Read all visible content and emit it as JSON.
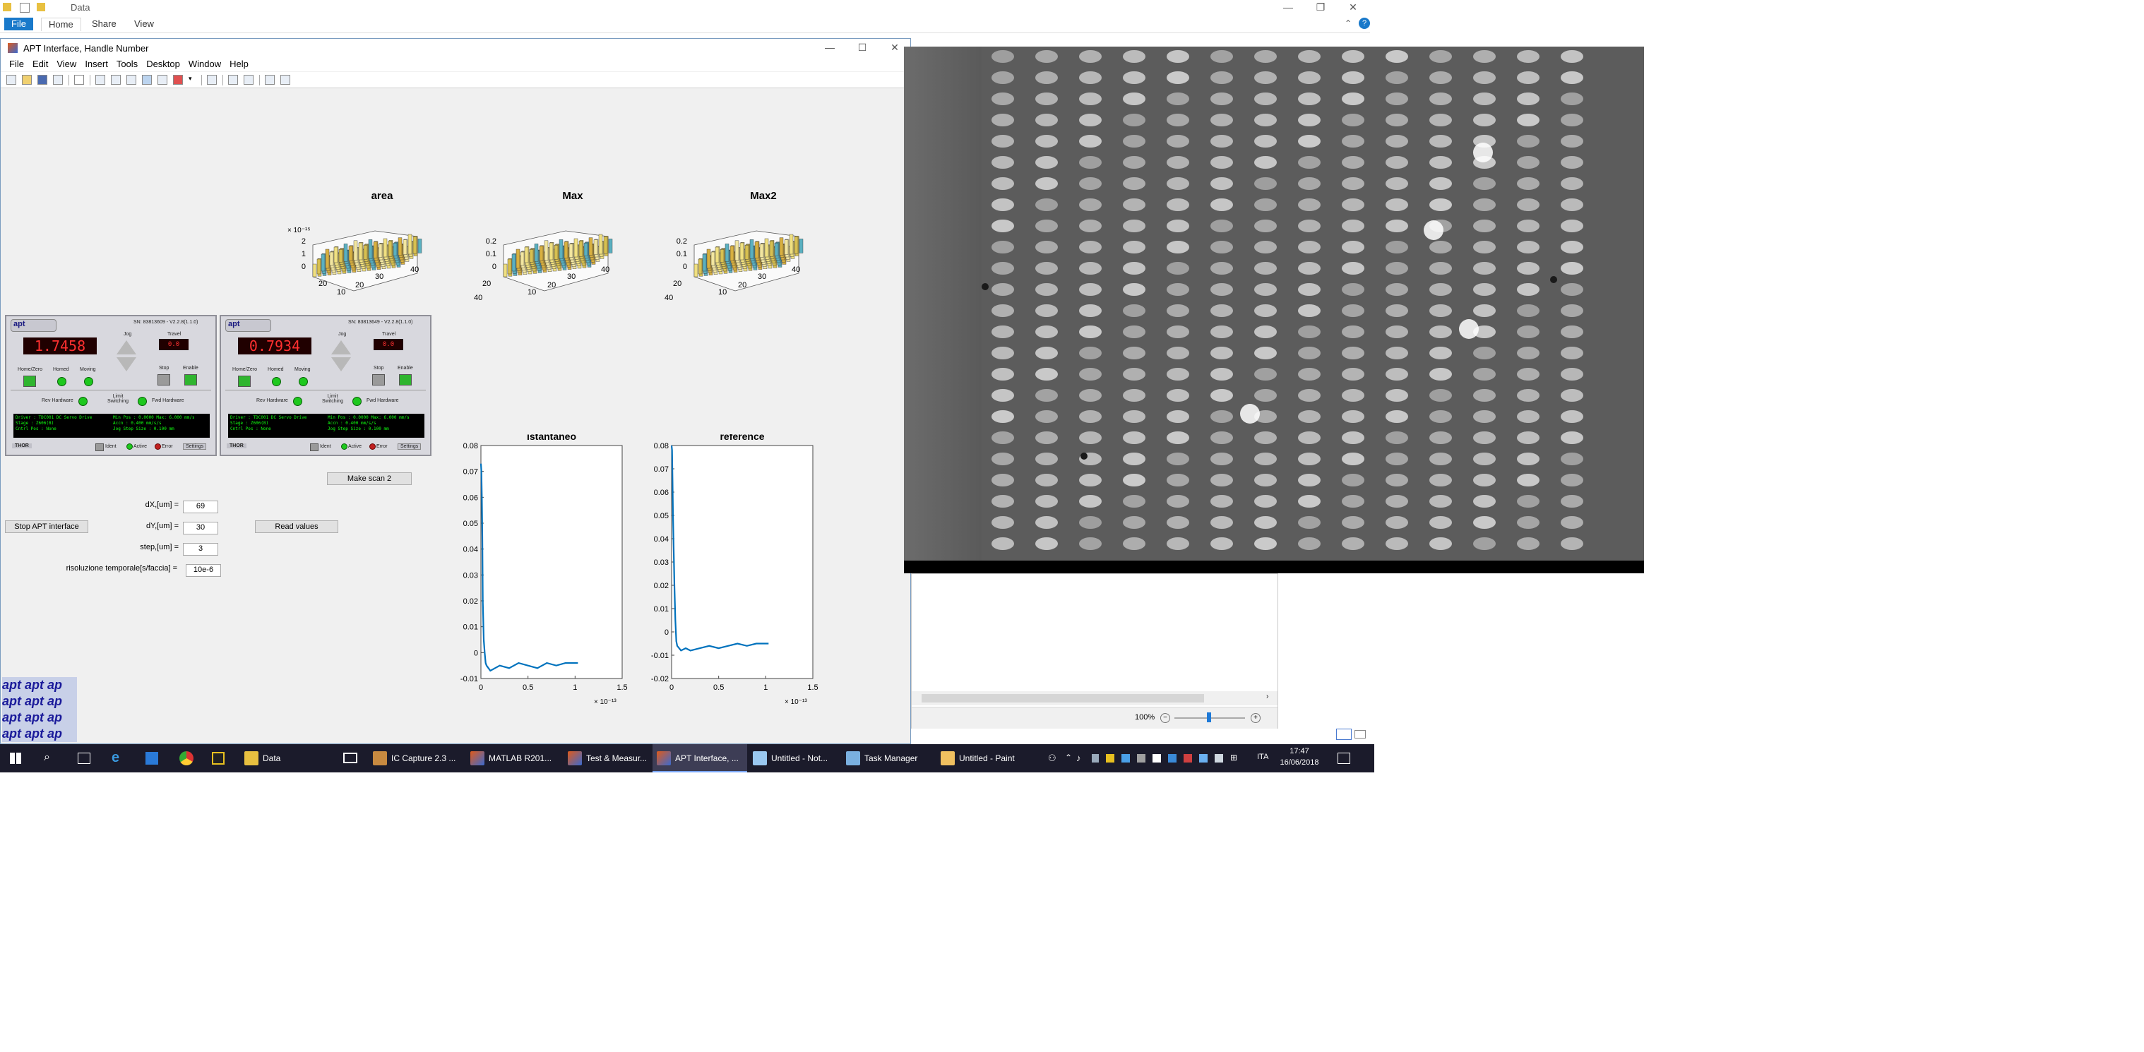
{
  "explorer": {
    "title": "Data",
    "tabs": [
      "File",
      "Home",
      "Share",
      "View"
    ],
    "help": "?"
  },
  "figure": {
    "title": "APT Interface, Handle Number",
    "menu": [
      "File",
      "Edit",
      "View",
      "Insert",
      "Tools",
      "Desktop",
      "Window",
      "Help"
    ],
    "plots3d": [
      {
        "title": "area",
        "exponent": "× 10⁻¹⁵",
        "zticks": [
          "2",
          "1",
          "0"
        ],
        "xticks": [
          "20",
          "10",
          "0"
        ],
        "yticks": [
          "10",
          "20",
          "30",
          "40"
        ]
      },
      {
        "title": "Max",
        "exponent": "",
        "zticks": [
          "0.2",
          "0.1",
          "0"
        ],
        "xticks": [
          "40",
          "20",
          "0"
        ],
        "yticks": [
          "10",
          "20",
          "30",
          "40"
        ]
      },
      {
        "title": "Max2",
        "exponent": "",
        "zticks": [
          "0.2",
          "0.1",
          "0"
        ],
        "xticks": [
          "40",
          "20",
          "0"
        ],
        "yticks": [
          "10",
          "20",
          "30",
          "40"
        ]
      }
    ],
    "apt": [
      {
        "display": "1.7458",
        "sn": "SN: 83813609 - V2.2.8(1.1.0)",
        "travel": "0.0",
        "console_l": "Driver : TDC001 DC Servo Drive\nStage : Z606(B)\nCntrl Pos : None",
        "console_r": "Min Pos : 0.0000 Max: 6.000 mm/s\nAccn : 0.400 mm/s/s\nJog Step Size : 0.100 mm"
      },
      {
        "display": "0.7934",
        "sn": "SN: 83813649 - V2.2.8(1.1.0)",
        "travel": "0.0",
        "console_l": "Driver : TDC001 DC Servo Drive\nStage : Z606(B)\nCntrl Pos : None",
        "console_r": "Min Pos : 0.0000 Max: 6.000 mm/s\nAccn : 0.400 mm/s/s\nJog Step Size : 0.100 mm"
      }
    ],
    "apt_labels": {
      "jog": "Jog",
      "travel": "Travel",
      "homezero": "Home/Zero",
      "homed": "Homed",
      "moving": "Moving",
      "stop": "Stop",
      "enable": "Enable",
      "revhw": "Rev Hardware",
      "limit": "Limit Switching",
      "fwdhw": "Fwd Hardware",
      "thor": "THOR",
      "ident": "Ident",
      "active": "Active",
      "error": "Error",
      "settings": "Settings",
      "brand": "apt"
    },
    "buttons": {
      "make_scan": "Make scan 2",
      "stop_apt": "Stop APT interface",
      "read_values": "Read values"
    },
    "fields": [
      {
        "label": "dX,[um] =",
        "value": "69"
      },
      {
        "label": "dY,[um] =",
        "value": "30"
      },
      {
        "label": "step,[um] =",
        "value": "3"
      },
      {
        "label": "risoluzione temporale[s/faccia] =",
        "value": "10e-6"
      }
    ],
    "apt_text_lines": [
      "apt apt ap",
      "apt apt ap",
      "apt apt ap",
      "apt apt ap"
    ]
  },
  "chart_data": [
    {
      "type": "line",
      "title": "istantaneo",
      "ylim": [
        -0.01,
        0.08
      ],
      "yticks": [
        "0.08",
        "0.07",
        "0.06",
        "0.05",
        "0.04",
        "0.03",
        "0.02",
        "0.01",
        "0",
        "-0.01"
      ],
      "xlim": [
        0,
        1.5
      ],
      "xticks": [
        "0",
        "0.5",
        "1",
        "1.5"
      ],
      "xexponent": "× 10⁻¹³",
      "series": [
        {
          "x": [
            0.0,
            0.005,
            0.01,
            0.015,
            0.02,
            0.03,
            0.04,
            0.05,
            0.06,
            0.08,
            0.1,
            0.15,
            0.2,
            0.3,
            0.4,
            0.5,
            0.6,
            0.7,
            0.8,
            0.9,
            1.0,
            1.03
          ],
          "y": [
            0.073,
            0.07,
            0.06,
            0.045,
            0.02,
            0.005,
            0.0,
            -0.004,
            -0.005,
            -0.006,
            -0.007,
            -0.006,
            -0.005,
            -0.006,
            -0.004,
            -0.005,
            -0.006,
            -0.004,
            -0.005,
            -0.004,
            -0.004,
            -0.004
          ]
        }
      ]
    },
    {
      "type": "line",
      "title": "reference",
      "ylim": [
        -0.02,
        0.08
      ],
      "yticks": [
        "0.08",
        "0.07",
        "0.06",
        "0.05",
        "0.04",
        "0.03",
        "0.02",
        "0.01",
        "0",
        "-0.01",
        "-0.02"
      ],
      "xlim": [
        0,
        1.5
      ],
      "xticks": [
        "0",
        "0.5",
        "1",
        "1.5"
      ],
      "xexponent": "× 10⁻¹³",
      "series": [
        {
          "x": [
            0.0,
            0.005,
            0.01,
            0.015,
            0.02,
            0.03,
            0.04,
            0.05,
            0.06,
            0.08,
            0.1,
            0.15,
            0.2,
            0.3,
            0.4,
            0.5,
            0.6,
            0.7,
            0.8,
            0.9,
            1.0,
            1.03
          ],
          "y": [
            0.08,
            0.078,
            0.065,
            0.05,
            0.04,
            0.02,
            0.005,
            -0.004,
            -0.006,
            -0.007,
            -0.008,
            -0.007,
            -0.008,
            -0.007,
            -0.006,
            -0.007,
            -0.006,
            -0.005,
            -0.006,
            -0.005,
            -0.005,
            -0.005
          ]
        }
      ]
    }
  ],
  "paint": {
    "zoom": "100%"
  },
  "taskbar": {
    "items": [
      "Data",
      "IC Capture 2.3 ...",
      "MATLAB R201...",
      "Test & Measur...",
      "APT Interface, ...",
      "Untitled - Not...",
      "Task Manager",
      "Untitled - Paint"
    ],
    "lang": "ITA",
    "time": "17:47",
    "date": "16/06/2018"
  }
}
